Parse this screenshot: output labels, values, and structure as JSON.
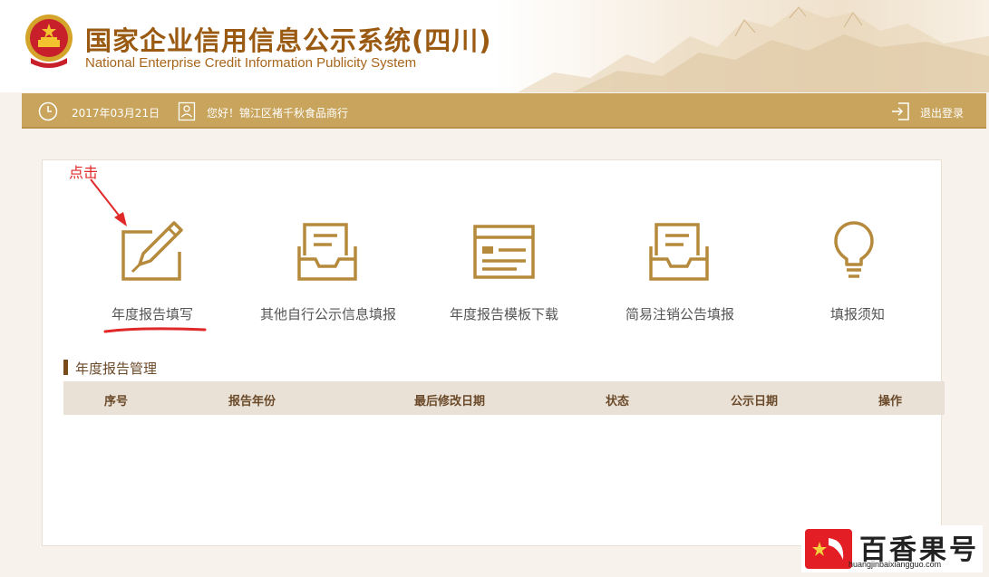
{
  "header": {
    "title_cn": "国家企业信用信息公示系统(四川)",
    "title_en": "National Enterprise Credit Information Publicity System"
  },
  "infobar": {
    "date": "2017年03月21日",
    "greeting": "您好！锦江区褚千秋食品商行",
    "logout": "退出登录"
  },
  "annotation": {
    "click_hint": "点击"
  },
  "tiles": [
    {
      "label": "年度报告填写",
      "icon": "edit-pencil-icon"
    },
    {
      "label": "其他自行公示信息填报",
      "icon": "inbox-tray-icon"
    },
    {
      "label": "年度报告模板下载",
      "icon": "template-window-icon"
    },
    {
      "label": "简易注销公告填报",
      "icon": "inbox-tray-icon"
    },
    {
      "label": "填报须知",
      "icon": "lightbulb-icon"
    }
  ],
  "section": {
    "title": "年度报告管理",
    "columns": [
      "序号",
      "报告年份",
      "最后修改日期",
      "状态",
      "公示日期",
      "操作"
    ]
  },
  "watermark": {
    "name": "百香果号",
    "url": "huangjinbaixiangguo.com"
  },
  "colors": {
    "accent": "#c8a45c",
    "icon_gold": "#b58a3c",
    "title_brown": "#9a5a12",
    "annotation_red": "#e02828"
  }
}
